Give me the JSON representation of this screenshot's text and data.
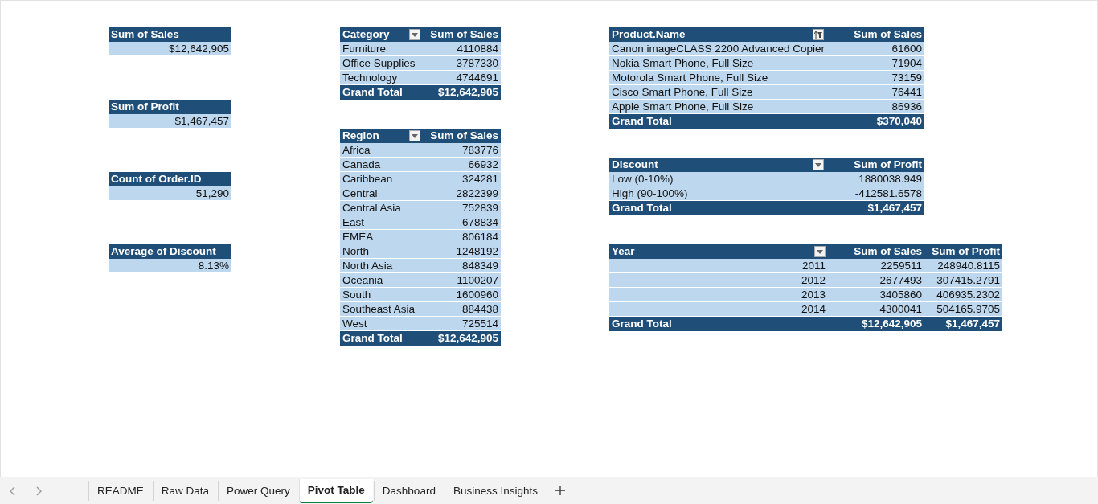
{
  "value_cards": [
    {
      "header": "Sum of Sales",
      "value": "$12,642,905"
    },
    {
      "header": "Sum of Profit",
      "value": "$1,467,457"
    },
    {
      "header": "Count of Order.ID",
      "value": "51,290"
    },
    {
      "header": "Average of Discount",
      "value": "8.13%"
    }
  ],
  "pivot_columns": [
    [
      {
        "kind": "labels",
        "columns": [
          {
            "label": "Category",
            "filter": {
              "kind": "dropdown"
            }
          },
          {
            "label": "Sum of Sales"
          }
        ],
        "rows": [
          [
            "Furniture",
            "4110884"
          ],
          [
            "Office Supplies",
            "3787330"
          ],
          [
            "Technology",
            "4744691"
          ]
        ],
        "grand_total": [
          "Grand Total",
          "$12,642,905"
        ]
      },
      {
        "kind": "labels",
        "columns": [
          {
            "label": "Region",
            "filter": {
              "kind": "dropdown"
            }
          },
          {
            "label": "Sum of Sales"
          }
        ],
        "rows": [
          [
            "Africa",
            "783776"
          ],
          [
            "Canada",
            "66932"
          ],
          [
            "Caribbean",
            "324281"
          ],
          [
            "Central",
            "2822399"
          ],
          [
            "Central Asia",
            "752839"
          ],
          [
            "East",
            "678834"
          ],
          [
            "EMEA",
            "806184"
          ],
          [
            "North",
            "1248192"
          ],
          [
            "North Asia",
            "848349"
          ],
          [
            "Oceania",
            "1100207"
          ],
          [
            "South",
            "1600960"
          ],
          [
            "Southeast Asia",
            "884438"
          ],
          [
            "West",
            "725514"
          ]
        ],
        "grand_total": [
          "Grand Total",
          "$12,642,905"
        ]
      }
    ],
    [
      {
        "kind": "labels",
        "columns": [
          {
            "label": "Product.Name",
            "filter": {
              "kind": "sorted"
            }
          },
          {
            "label": "Sum of Sales"
          }
        ],
        "rows": [
          [
            "Canon imageCLASS 2200 Advanced Copier",
            "61600"
          ],
          [
            "Nokia Smart Phone, Full Size",
            "71904"
          ],
          [
            "Motorola Smart Phone, Full Size",
            "73159"
          ],
          [
            "Cisco Smart Phone, Full Size",
            "76441"
          ],
          [
            "Apple Smart Phone, Full Size",
            "86936"
          ]
        ],
        "grand_total": [
          "Grand Total",
          "$370,040"
        ]
      },
      {
        "kind": "labels",
        "columns": [
          {
            "label": "Discount",
            "filter": {
              "kind": "dropdown"
            }
          },
          {
            "label": "Sum of Profit"
          }
        ],
        "rows": [
          [
            "Low (0-10%)",
            "1880038.949"
          ],
          [
            "High (90-100%)",
            "-412581.6578"
          ]
        ],
        "grand_total": [
          "Grand Total",
          "$1,467,457"
        ]
      },
      {
        "kind": "numbers",
        "columns": [
          {
            "label": "Year",
            "filter": {
              "kind": "dropdown"
            }
          },
          {
            "label": "Sum of Sales"
          },
          {
            "label": "Sum of Profit"
          }
        ],
        "rows": [
          [
            "2011",
            "2259511",
            "248940.8115"
          ],
          [
            "2012",
            "2677493",
            "307415.2791"
          ],
          [
            "2013",
            "3405860",
            "406935.2302"
          ],
          [
            "2014",
            "4300041",
            "504165.9705"
          ]
        ],
        "grand_total": [
          "Grand Total",
          "$12,642,905",
          "$1,467,457"
        ]
      }
    ]
  ],
  "sheet_tabs": [
    {
      "label": "README",
      "selected": false
    },
    {
      "label": "Raw Data",
      "selected": false
    },
    {
      "label": "Power Query",
      "selected": false
    },
    {
      "label": "Pivot Table",
      "selected": true
    },
    {
      "label": "Dashboard",
      "selected": false
    },
    {
      "label": "Business Insights",
      "selected": false
    }
  ]
}
